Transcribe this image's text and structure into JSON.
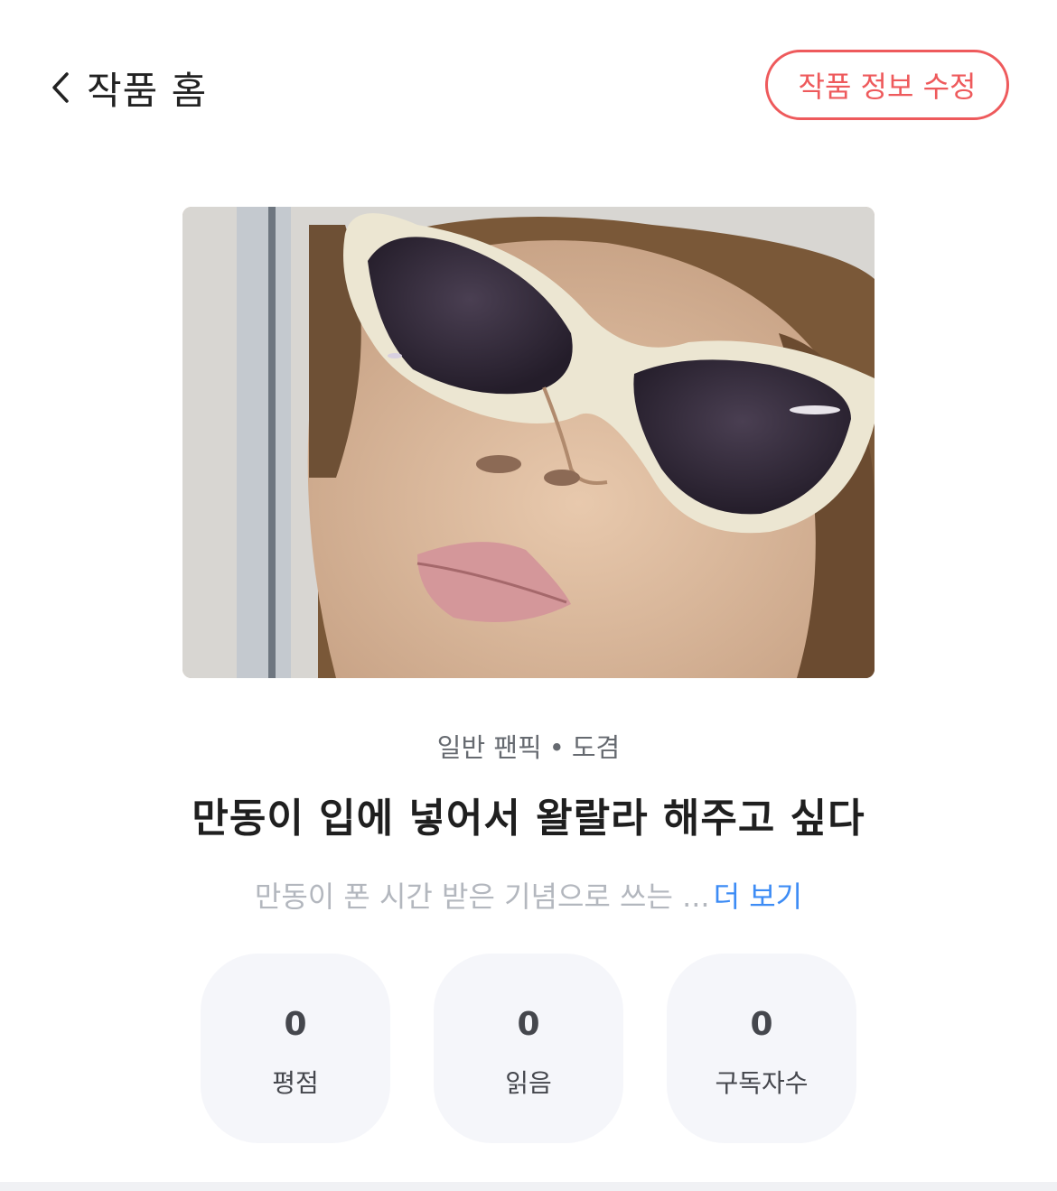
{
  "header": {
    "back_icon": "chevron-left-icon",
    "title": "작품 홈",
    "edit_button": "작품 정보 수정",
    "accent_color": "#ee5a5c"
  },
  "work": {
    "category": "일반 팬픽",
    "separator": "•",
    "tag": "도겸",
    "title": "만동이 입에 넣어서 왈랄라 해주고 싶다",
    "description": "만동이 폰 시간 받은 기념으로 쓰는 ...",
    "more_label": "더 보기",
    "link_color": "#3d8cf5"
  },
  "stats": [
    {
      "value": "0",
      "label": "평점"
    },
    {
      "value": "0",
      "label": "읽음"
    },
    {
      "value": "0",
      "label": "구독자수"
    }
  ]
}
